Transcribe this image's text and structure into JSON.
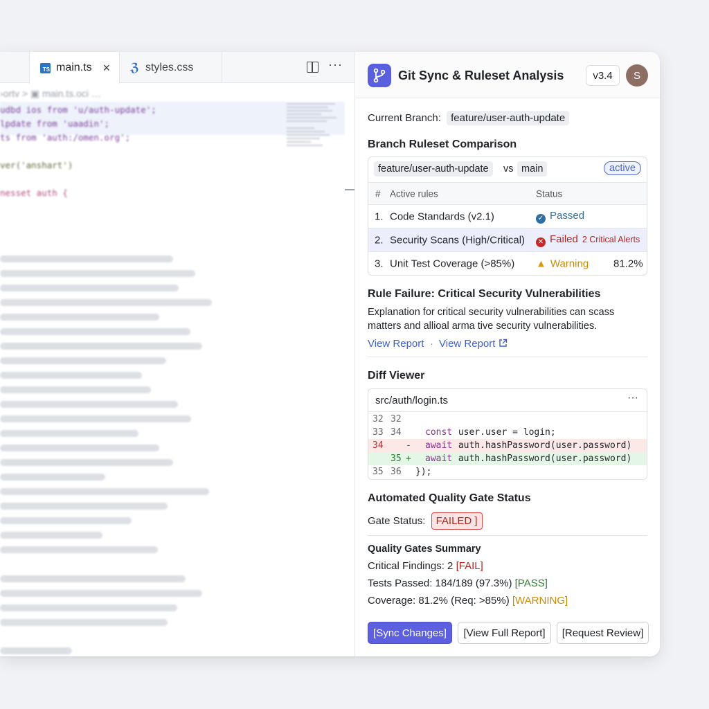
{
  "editor": {
    "tabs": [
      {
        "label": "main.ts",
        "icon": "typescript-icon",
        "active": true
      },
      {
        "label": "styles.css",
        "icon": "css-icon",
        "active": false
      }
    ],
    "ts_badge": "TS",
    "breadcrumb": "›ortv  >  ▣ main.ts.oci  …",
    "code_lines": [
      "udbd ios from 'u/auth-update';",
      "lpdate from 'uaadin';",
      "ts from 'auth:/omen.org';",
      "",
      "ver('anshart')",
      "",
      "nesset auth {"
    ]
  },
  "panel": {
    "title": "Git Sync & Ruleset Analysis",
    "version": "v3.4",
    "avatar_initial": "S",
    "current_branch_label": "Current Branch:",
    "current_branch": "feature/user-auth-update",
    "comparison": {
      "heading": "Branch Ruleset Comparison",
      "branch_a": "feature/user-auth-update",
      "vs": "vs",
      "branch_b": "main",
      "state": "active",
      "col_num": "#",
      "col_rules": "Active rules",
      "col_status": "Status",
      "rules": [
        {
          "num": "1.",
          "name": "Code Standards (v2.1)",
          "status": "Passed",
          "extra": ""
        },
        {
          "num": "2.",
          "name": "Security Scans (High/Critical)",
          "status": "Failed",
          "extra": "2 Critical Alerts"
        },
        {
          "num": "3.",
          "name": "Unit Test Coverage (>85%)",
          "status": "Warning",
          "extra": "81.2%"
        }
      ]
    },
    "failure": {
      "heading": "Rule Failure: Critical Security Vulnerabilities",
      "line1": "Explanation for critical security vulnerabilities can scass",
      "line2": "matters and allioal arma tive security vulnerabilities.",
      "link1": "View Report",
      "sep": "·",
      "link2": "View Report"
    },
    "diff": {
      "heading": "Diff Viewer",
      "file": "src/auth/login.ts",
      "lines": [
        {
          "old": "32",
          "new": "32",
          "sign": "",
          "pre": "",
          "kw": "",
          "code": ""
        },
        {
          "old": "33",
          "new": "34",
          "sign": "",
          "pre": "  ",
          "kw": "const",
          "code": " user.user = login;"
        },
        {
          "old": "34",
          "new": "",
          "sign": "-",
          "pre": "  ",
          "kw": "await",
          "code": " auth.hashPassword(user.password)"
        },
        {
          "old": "",
          "new": "35",
          "sign": "+",
          "pre": "  ",
          "kw": "await",
          "code": " auth.hashPassword(user.password)"
        },
        {
          "old": "35",
          "new": "36",
          "sign": "",
          "pre": "",
          "kw": "",
          "code": "});"
        }
      ]
    },
    "gate": {
      "heading": "Automated Quality Gate Status",
      "label": "Gate Status:",
      "value": "FAILED ]"
    },
    "summary": {
      "heading": "Quality Gates Summary",
      "critical_text": "Critical Findings: 2",
      "critical_tag": "[FAIL]",
      "tests_text": "Tests Passed: 184/189 (97.3%)",
      "tests_tag": "[PASS]",
      "coverage_text": "Coverage: 81.2% (Req: >85%)",
      "coverage_tag": "[WARNING]"
    },
    "buttons": {
      "sync": "[Sync Changes]",
      "report": "[View Full Report]",
      "review": "[Request Review]"
    }
  },
  "colors": {
    "accent": "#5b5fe0",
    "fail": "#b3261e",
    "pass": "#2e7d32",
    "warn": "#c88a06",
    "link": "#3f5fc8"
  }
}
